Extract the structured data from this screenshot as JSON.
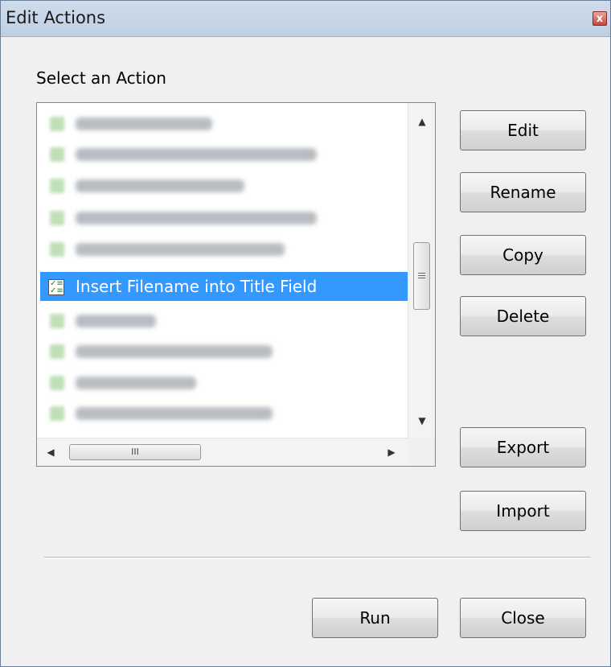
{
  "window": {
    "title": "Edit Actions",
    "close_glyph": "x"
  },
  "prompt": "Select an Action",
  "list": {
    "selected_label": "Insert Filename into Title Field",
    "blurred_items_before": 5,
    "blurred_items_after": 4
  },
  "hscroll_grip": "III",
  "buttons": {
    "edit": "Edit",
    "rename": "Rename",
    "copy": "Copy",
    "delete": "Delete",
    "export": "Export",
    "import": "Import",
    "run": "Run",
    "close": "Close"
  }
}
